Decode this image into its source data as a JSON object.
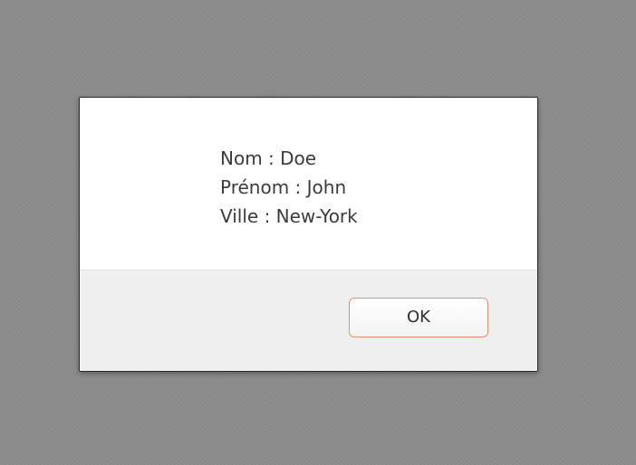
{
  "dialog": {
    "lines": [
      "Nom : Doe",
      "Prénom : John",
      "Ville : New-York"
    ],
    "ok_label": "OK"
  }
}
